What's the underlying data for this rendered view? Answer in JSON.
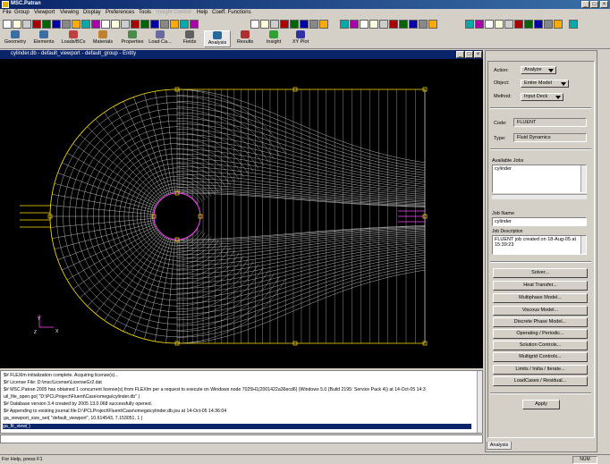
{
  "window": {
    "title": "MSC.Patran"
  },
  "menu": {
    "items": [
      "File",
      "Group",
      "Viewport",
      "Viewing",
      "Display",
      "Preferences",
      "Tools",
      "Insight Control",
      "Help",
      "Coeff. Functions"
    ]
  },
  "apptabs": [
    {
      "label": "Geometry",
      "color": "#3a6ea5"
    },
    {
      "label": "Elements",
      "color": "#3a6ea5"
    },
    {
      "label": "Loads/BCs",
      "color": "#c04040"
    },
    {
      "label": "Materials",
      "color": "#c08030"
    },
    {
      "label": "Properties",
      "color": "#4a8a4a"
    },
    {
      "label": "Load Ca...",
      "color": "#6a6aa0"
    },
    {
      "label": "Fields",
      "color": "#606060"
    },
    {
      "label": "Analysis",
      "color": "#2a6a9a"
    },
    {
      "label": "Results",
      "color": "#b03030"
    },
    {
      "label": "Insight",
      "color": "#30a030"
    },
    {
      "label": "XY Plot",
      "color": "#3030a0"
    }
  ],
  "viewport": {
    "title": "cylinder.db - default_viewport - default_group - Entity",
    "axis_y": "Y",
    "axis_x": "X",
    "axis_z": "Z"
  },
  "history": {
    "lines": [
      "$# FLEXlm initialization complete.  Acquiring license(s)...",
      "$# License File: D:\\msc\\License\\LicenseGr2.dat",
      "$# MSC.Patran 2005 has obtained 1 concurrent license(s) from FLEXlm per a request to execute on Windows node 7025H1(2001422a36ecd6) (Windows 5.0 (Build 2195: Service Pack 4)) at 14-Oct-05 14:3",
      "uil_file_open.go( \"D:\\PCLProject\\Fluent\\Case\\omega\\cylinder.db\" )",
      "$# Database version 3.4 created by 2005 13.0.068 successfully opened.",
      "$# Appending to existing journal file D:\\PCLProject\\Fluent\\Case\\omega\\cylinder.db.jou at 14-Oct-05 14:36:04",
      "ga_viewport_size_set( \"default_viewport\", 10.614543, 7.153051, 1 )",
      "ga_fit_view( )"
    ]
  },
  "status": {
    "text": "For Help, press F1",
    "num": "NUM"
  },
  "panel": {
    "action_label": "Action:",
    "action_value": "Analyze",
    "object_label": "Object:",
    "object_value": "Entire Model",
    "method_label": "Method:",
    "method_value": "Input Deck",
    "code_label": "Code:",
    "code_value": "FLUENT",
    "type_label": "Type:",
    "type_value": "Fluid Dynamics",
    "jobs_label": "Available Jobs",
    "jobs": [
      "cylinder"
    ],
    "jobname_label": "Job Name",
    "jobname_value": "cylinder",
    "jobdesc_label": "Job Description",
    "jobdesc_value": "FLUENT job created on 18-Aug-05 at 15:39:23",
    "buttons": [
      "Solver...",
      "Heat Transfer...",
      "Multiphase Model...",
      "Viscous Model...",
      "Discrete Phase Model...",
      "Operating / Periodic...",
      "Solution Controls...",
      "Multigrid Controls...",
      "Limits / Initia / Iterate...",
      "LoadCases / Residual..."
    ],
    "apply": "Apply",
    "tab": "Analysis"
  }
}
